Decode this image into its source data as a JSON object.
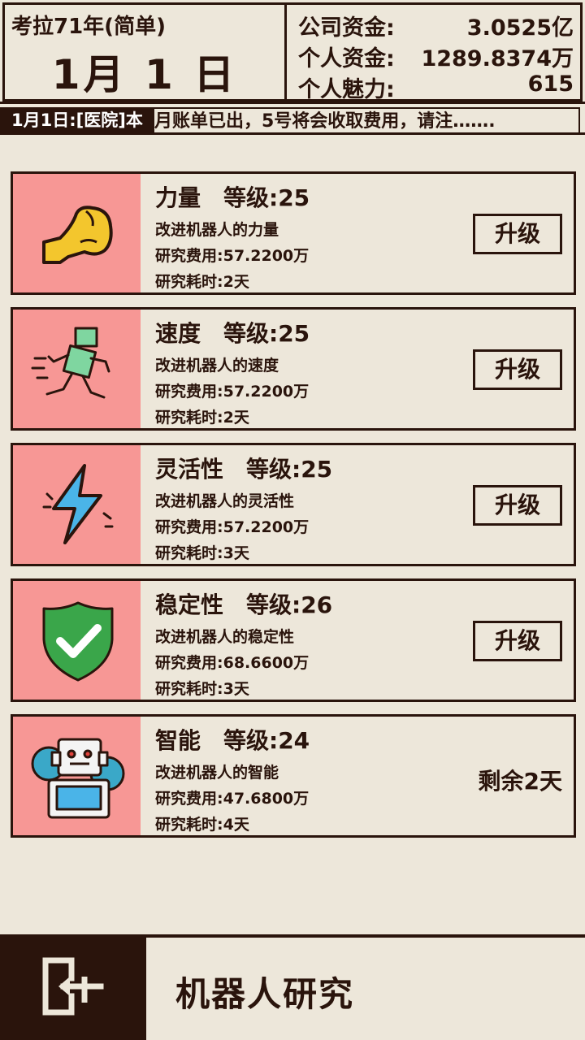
{
  "header": {
    "year_label": "考拉71年(简单)",
    "date_label": "1月 1 日",
    "stats": [
      {
        "label": "公司资金:",
        "value": "3.0525亿"
      },
      {
        "label": "个人资金:",
        "value": "1289.8374万"
      },
      {
        "label": "个人魅力:",
        "value": "615"
      }
    ]
  },
  "ticker": {
    "tag": "1月1日:[医院]本",
    "text": "月账单已出，5号将会收取费用，请注……."
  },
  "cards": [
    {
      "title": "力量　等级:25",
      "desc": "改进机器人的力量",
      "cost": "研究费用:57.2200万",
      "time": "研究耗时:2天",
      "button": "升级",
      "icon": "flexed-arm-icon"
    },
    {
      "title": "速度　等级:25",
      "desc": "改进机器人的速度",
      "cost": "研究费用:57.2200万",
      "time": "研究耗时:2天",
      "button": "升级",
      "icon": "running-robot-icon"
    },
    {
      "title": "灵活性　等级:25",
      "desc": "改进机器人的灵活性",
      "cost": "研究费用:57.2200万",
      "time": "研究耗时:3天",
      "button": "升级",
      "icon": "lightning-icon"
    },
    {
      "title": "稳定性　等级:26",
      "desc": "改进机器人的稳定性",
      "cost": "研究费用:68.6600万",
      "time": "研究耗时:3天",
      "button": "升级",
      "icon": "shield-check-icon"
    },
    {
      "title": "智能　等级:24",
      "desc": "改进机器人的智能",
      "cost": "研究费用:47.6800万",
      "time": "研究耗时:4天",
      "remaining": "剩余2天",
      "icon": "robot-gear-icon"
    }
  ],
  "footer": {
    "title": "机器人研究",
    "exit_icon": "exit-door-icon"
  },
  "colors": {
    "background": "#ede7da",
    "ink": "#2a140c",
    "icon_bg": "#f79795"
  }
}
